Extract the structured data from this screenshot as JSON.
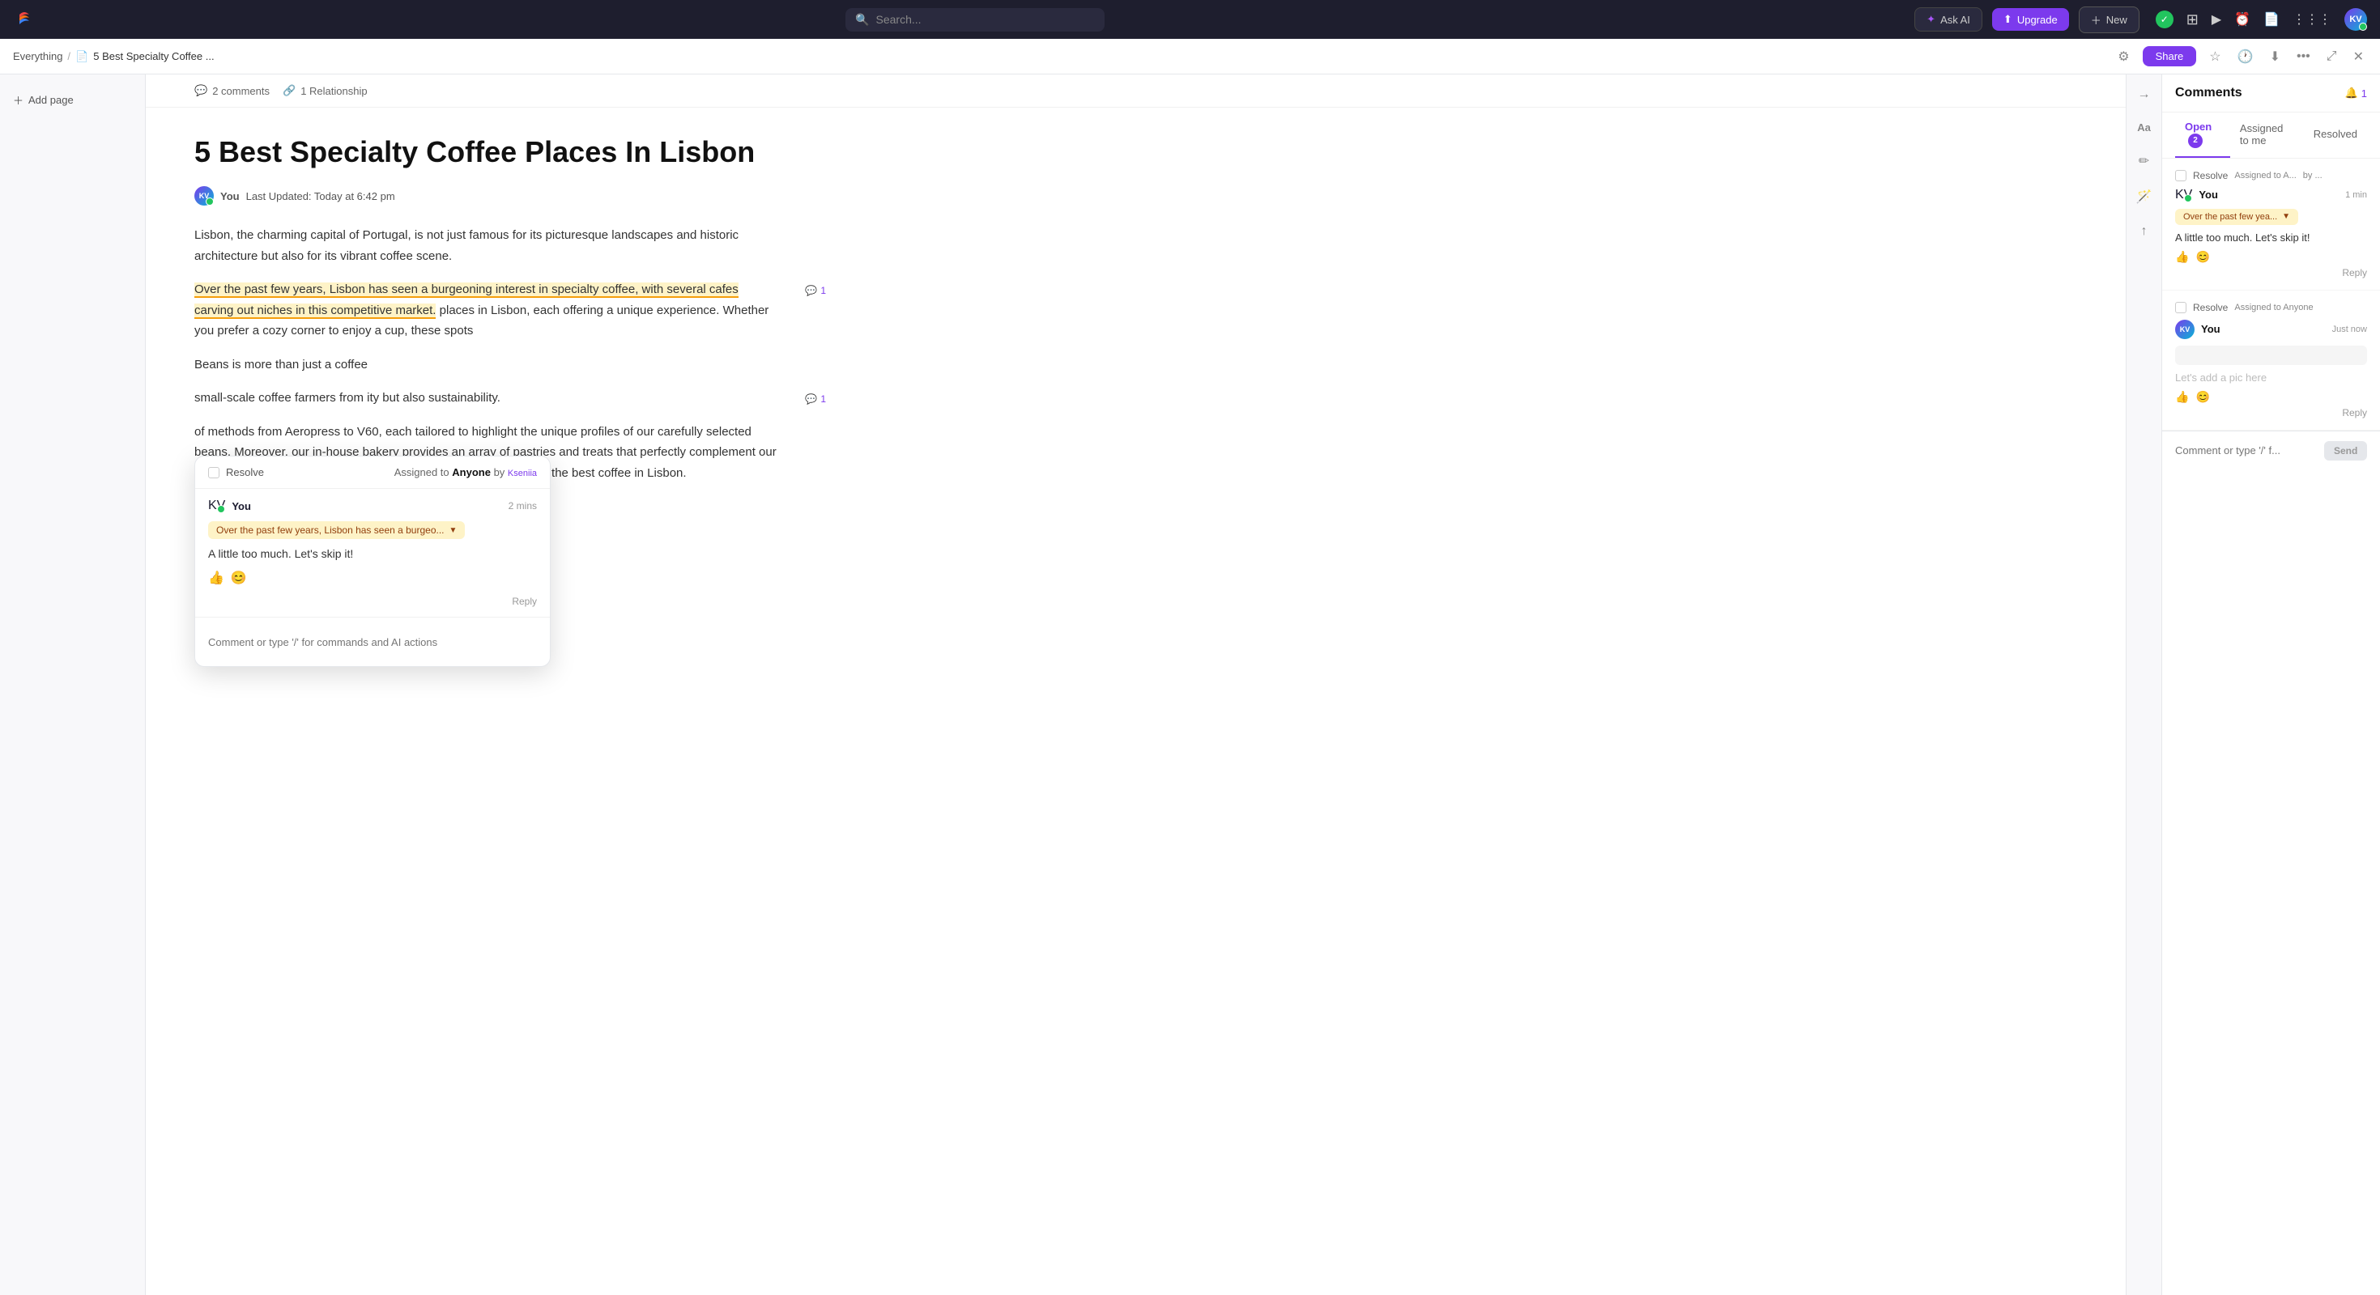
{
  "topnav": {
    "search_placeholder": "Search...",
    "ask_ai_label": "Ask AI",
    "upgrade_label": "Upgrade",
    "new_label": "New",
    "avatar_initials": "KV"
  },
  "secondbar": {
    "breadcrumb_root": "Everything",
    "breadcrumb_sep": "/",
    "breadcrumb_doc": "5 Best Specialty Coffee ...",
    "share_label": "Share"
  },
  "sidebar": {
    "add_page_label": "Add page"
  },
  "doc": {
    "meta_comments": "2 comments",
    "meta_relationship": "1 Relationship",
    "title": "5 Best Specialty Coffee Places In Lisbon",
    "author": "You",
    "last_updated": "Last Updated: Today at 6:42 pm",
    "body_p1": "Lisbon, the charming capital of Portugal, is not just famous for its picturesque landscapes and historic architecture but also for its vibrant coffee scene.",
    "body_p2_highlighted": "Over the past few years, Lisbon has seen a burgeoning interest in specialty coffee, with several cafes carving out niches in this competitive market.",
    "body_p2_rest": " places in Lisbon, each offering a unique experience. Whether you prefer a cozy corner to enjoy a cup, these spots",
    "body_p3_rest": " Beans is more than just a coffee",
    "body_p4": "small-scale coffee farmers from ity but also sustainability.",
    "body_p5": "of methods from Aeropress to V60, each tailored to highlight the unique profiles of our carefully selected beans. Moreover, our in-house bakery provides an array of pastries and treats that perfectly complement our brews, making Happy Beans a must-visit for anyone searching for the best coffee in Lisbon.",
    "comment_count_1": "1",
    "comment_count_2": "1"
  },
  "popup": {
    "resolve_label": "Resolve",
    "assigned_to": "Assigned to",
    "anyone": "Anyone",
    "by": "by",
    "by_name": "Kseniia",
    "author": "You",
    "time": "2 mins",
    "quote_text": "Over the past few years, Lisbon has seen a burgeo...",
    "comment_text": "A little too much. Let's skip it!",
    "reply_label": "Reply",
    "input_placeholder": "Comment or type '/' for commands and AI actions"
  },
  "comments_panel": {
    "title": "Comments",
    "bell_count": "1",
    "tab_open": "Open",
    "tab_open_count": "2",
    "tab_assigned": "Assigned to me",
    "tab_resolved": "Resolved",
    "c1_resolve": "Resolve",
    "c1_assigned": "Assigned to A...",
    "c1_by": "by ...",
    "c1_author": "You",
    "c1_time": "1 min",
    "c1_quote": "Over the past few yea...",
    "c1_text": "A little too much. Let's skip it!",
    "c1_reply": "Reply",
    "c2_resolve": "Resolve",
    "c2_assigned": "Assigned to Anyone",
    "c2_author": "You",
    "c2_time": "Just now",
    "c2_quote_placeholder": "",
    "c2_text": "Let's add a pic here",
    "c2_reply": "Reply",
    "input_placeholder": "Comment or type '/' f...",
    "send_label": "Send"
  }
}
